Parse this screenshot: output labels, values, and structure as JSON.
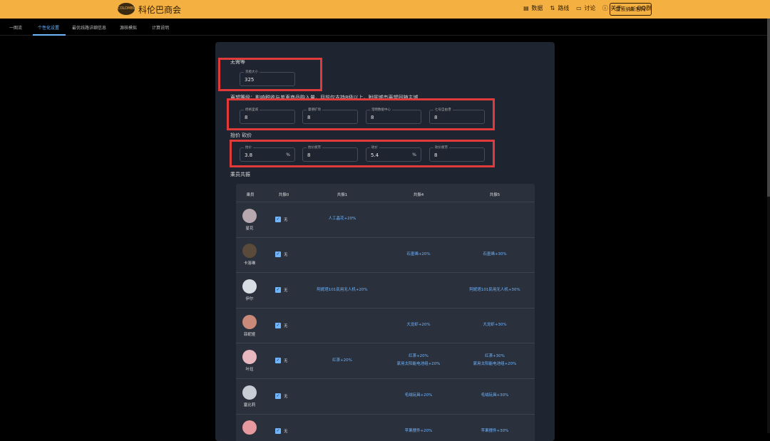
{
  "header": {
    "logo_text": "COLOMBIA",
    "brand": "科伦巴商会",
    "nav": [
      {
        "icon": "database-icon",
        "glyph": "▤",
        "label": "数据"
      },
      {
        "icon": "route-icon",
        "glyph": "⇅",
        "label": "路线"
      },
      {
        "icon": "chat-icon",
        "glyph": "▭",
        "label": "讨论"
      },
      {
        "icon": "info-icon",
        "glyph": "ⓘ",
        "label": "关于"
      },
      {
        "icon": "qq-icon",
        "glyph": "◬",
        "label": "QQ群"
      }
    ],
    "highlight_button": "雷索纳斯官网"
  },
  "tabs": [
    {
      "label": "一图流",
      "active": false
    },
    {
      "label": "个性化设置",
      "active": true
    },
    {
      "label": "最优线路详细信息",
      "active": false
    },
    {
      "label": "源核模拟",
      "active": false
    },
    {
      "label": "计算说明",
      "active": false
    }
  ],
  "sections": {
    "section1_title": "无需等",
    "cargo_label": "货舱大小",
    "cargo_value": "325",
    "section2_title": "声望等级：影响税收与单車商品购入量，目前仅支持8级以上，附属城市声望同随主城",
    "reputation": [
      {
        "label": "修格里城",
        "value": "8"
      },
      {
        "label": "曼德矿场",
        "value": "8"
      },
      {
        "label": "澄明数据中心",
        "value": "8"
      },
      {
        "label": "七号自由港",
        "value": "8"
      }
    ],
    "section3_title": "抬价 砍价",
    "bargain": [
      {
        "label": "抬价",
        "value": "3.8",
        "suffix": "%"
      },
      {
        "label": "抬价疲劳",
        "value": "8",
        "suffix": ""
      },
      {
        "label": "砍价",
        "value": "5.4",
        "suffix": "%"
      },
      {
        "label": "砍价疲劳",
        "value": "8",
        "suffix": ""
      }
    ],
    "section4_title": "乘员共振"
  },
  "table": {
    "headers": [
      "乘员",
      "共振0",
      "共振1",
      "共振4",
      "共振5"
    ],
    "none_label": "无",
    "rows": [
      {
        "name": "星花",
        "r1": "人工晶花+20%",
        "r4": "",
        "r5": "",
        "color": "#b7a8b0"
      },
      {
        "name": "卡洛琳",
        "r1": "",
        "r4": "石墨烯+20%",
        "r5": "石墨烯+30%",
        "color": "#5a4a3a"
      },
      {
        "name": "伊尔",
        "r1": "阿妮塔101民用无人机+20%",
        "r4": "",
        "r5": "阿妮塔101民用无人机+30%",
        "color": "#d8dde4"
      },
      {
        "name": "菲妮娅",
        "r1": "",
        "r4": "大龙虾+20%",
        "r5": "大龙虾+30%",
        "color": "#c98a7a"
      },
      {
        "name": "叶珏",
        "r1": "红茶+20%",
        "r4": "红茶+20%\n家用太阳能电池组+20%",
        "r5": "红茶+30%\n家用太阳能电池组+20%",
        "color": "#e7b8c0"
      },
      {
        "name": "塞比莉",
        "r1": "",
        "r4": "毛绒玩具+20%",
        "r5": "毛绒玩具+30%",
        "color": "#c8ccd4"
      },
      {
        "name": "",
        "r1": "",
        "r4": "苹果摆件+20%",
        "r5": "苹果摆件+30%",
        "color": "#e69aa0"
      }
    ]
  },
  "colors": {
    "accent": "#6fb6ff",
    "topbar": "#f5b042",
    "highlight": "#e03a3a"
  }
}
